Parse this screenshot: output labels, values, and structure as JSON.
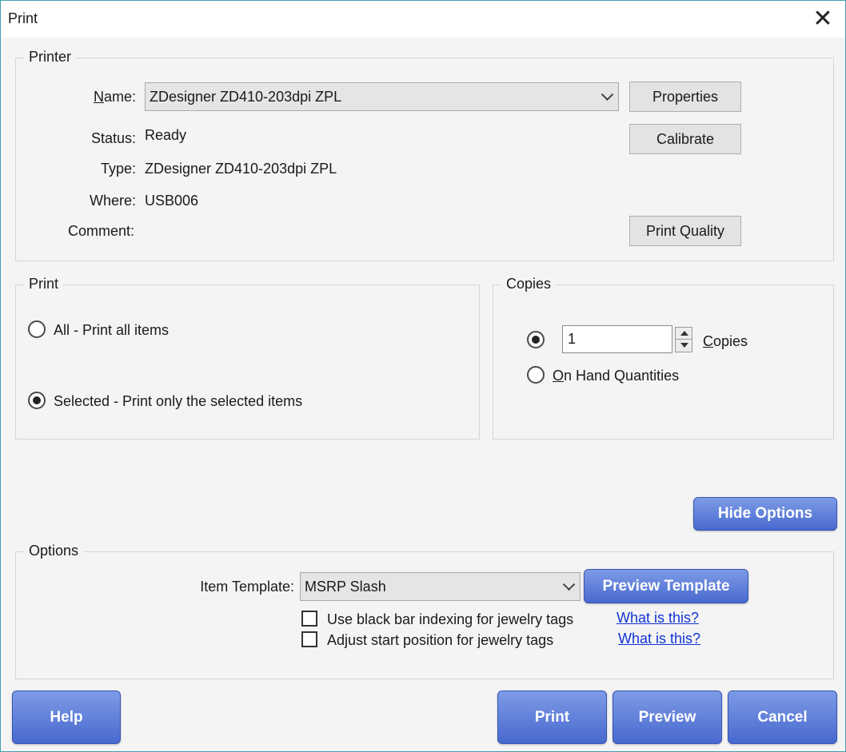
{
  "window": {
    "title": "Print",
    "close_glyph": "✕"
  },
  "printer": {
    "legend": "Printer",
    "name_label_u": "N",
    "name_label_rest": "ame:",
    "name_value": "ZDesigner ZD410-203dpi ZPL",
    "status_label": "Status:",
    "status_value": "Ready",
    "type_label": "Type:",
    "type_value": "ZDesigner ZD410-203dpi ZPL",
    "where_label": "Where:",
    "where_value": "USB006",
    "comment_label": "Comment:",
    "comment_value": "",
    "properties_label": "Properties",
    "calibrate_label": "Calibrate",
    "print_quality_label": "Print Quality"
  },
  "print_range": {
    "legend": "Print",
    "all_label": "All - Print all items",
    "selected_label": "Selected - Print only the selected items",
    "selected": "selected"
  },
  "copies": {
    "legend": "Copies",
    "value": "1",
    "copies_label_u": "C",
    "copies_label_rest": "opies",
    "on_hand_label_u": "O",
    "on_hand_label_rest": "n Hand Quantities",
    "selected": "copies"
  },
  "hide_options_label": "Hide Options",
  "options": {
    "legend": "Options",
    "item_template_label": "Item Template:",
    "item_template_value": "MSRP Slash",
    "preview_template_label": "Preview Template",
    "black_bar_label": "Use black bar indexing for jewelry tags",
    "black_bar_checked": false,
    "adjust_start_label": "Adjust start position for jewelry tags",
    "adjust_start_checked": false,
    "what_is_this_1": "What is this?",
    "what_is_this_2": "What is this?"
  },
  "footer": {
    "help_label": "Help",
    "print_label": "Print",
    "preview_label": "Preview",
    "cancel_label": "Cancel"
  },
  "colors": {
    "accent_button": "#5a7bdb",
    "link": "#1034d6",
    "window_border": "#3f9fb3"
  }
}
